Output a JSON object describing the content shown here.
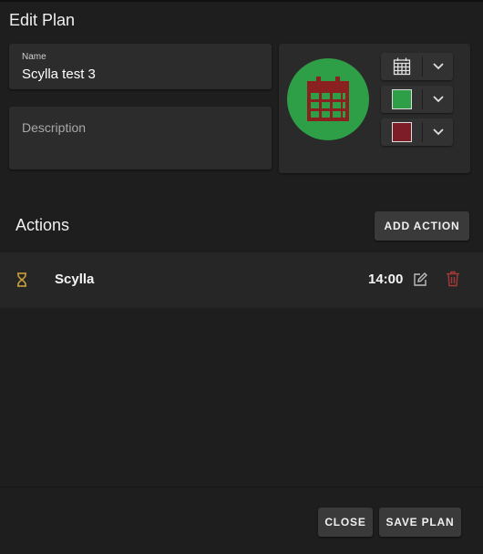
{
  "dialog": {
    "title": "Edit Plan"
  },
  "form": {
    "name_label": "Name",
    "name_value": "Scylla test 3",
    "description_placeholder": "Description"
  },
  "icon_panel": {
    "icon": "calendar-icon",
    "icon_color": "#8b2020",
    "background_color": "#2e9e47",
    "selected_color": "#2e9e47",
    "selected_icon_color": "#7d1d27"
  },
  "actions": {
    "title": "Actions",
    "add_label": "ADD ACTION",
    "items": [
      {
        "icon": "hourglass-icon",
        "name": "Scylla",
        "time": "14:00"
      }
    ]
  },
  "footer": {
    "close_label": "CLOSE",
    "save_label": "SAVE PLAN"
  },
  "colors": {
    "accent_hourglass": "#c9a03a",
    "trash": "#a63a3a"
  }
}
